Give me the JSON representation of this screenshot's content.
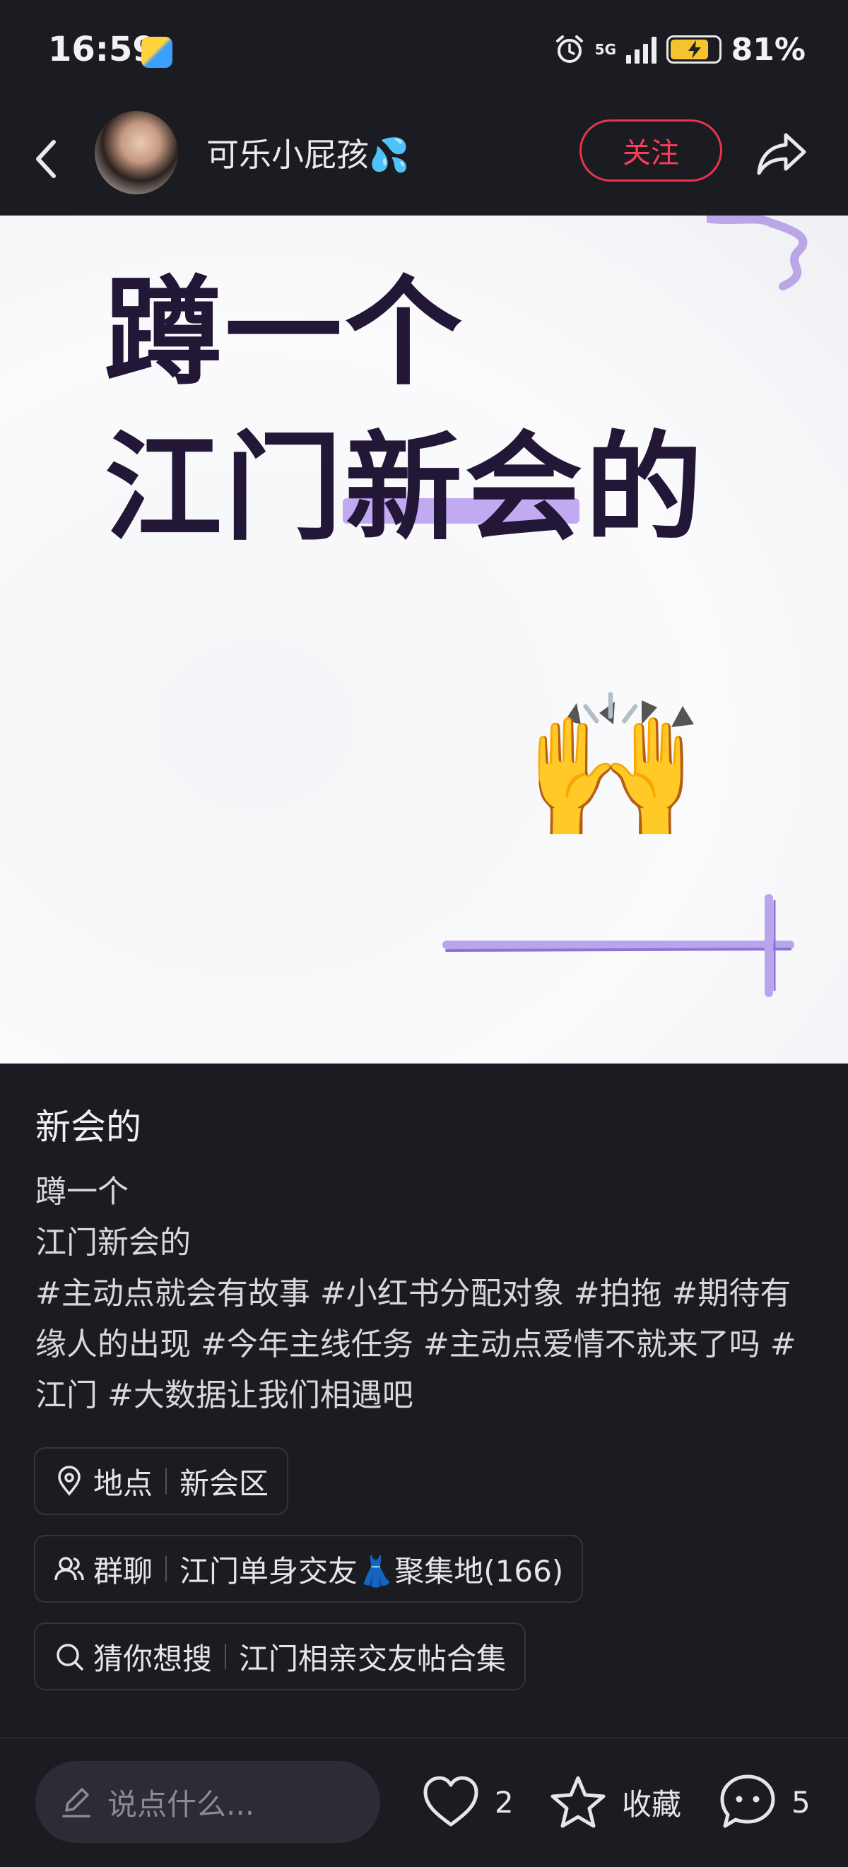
{
  "status_bar": {
    "time": "16:59",
    "network": "5G",
    "battery_percent": "81%",
    "battery_level": 0.81,
    "icons": [
      "app-notification-icon",
      "alarm-icon",
      "signal-icon",
      "battery-charging-icon"
    ]
  },
  "header": {
    "author_name": "可乐小屁孩💦",
    "follow_label": "关注"
  },
  "cover": {
    "line1": "蹲一个",
    "line2": "江门新会的",
    "emoji": "🙌"
  },
  "note": {
    "title": "新会的",
    "body_line1": "蹲一个",
    "body_line2": "江门新会的",
    "tags_text": "#主动点就会有故事 #小红书分配对象 #拍拖 #期待有缘人的出现 #今年主线任务 #主动点爱情不就来了吗 #江门 #大数据让我们相遇吧"
  },
  "chips": [
    {
      "label": "地点",
      "value": "新会区",
      "icon": "location-pin-icon"
    },
    {
      "label": "群聊",
      "value": "江门单身交友👗聚集地(166)",
      "icon": "group-icon"
    },
    {
      "label": "猜你想搜",
      "value": "江门相亲交友帖合集",
      "icon": "search-icon"
    }
  ],
  "bottom_bar": {
    "comment_placeholder": "说点什么...",
    "like_count": "2",
    "collect_label": "收藏",
    "comment_count": "5"
  },
  "colors": {
    "background": "#1b1b22",
    "accent_red": "#ff3b55",
    "cover_text": "#221737",
    "cover_highlight": "#b79cf0"
  }
}
